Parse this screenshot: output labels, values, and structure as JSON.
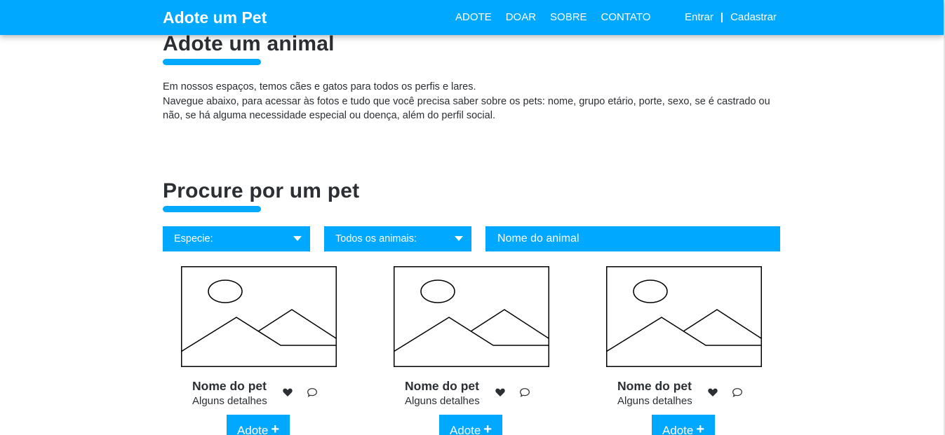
{
  "header": {
    "brand": "Adote um Pet",
    "nav": [
      "ADOTE",
      "DOAR",
      "SOBRE",
      "CONTATO"
    ],
    "login_label": "Entrar",
    "separator": "|",
    "signup_label": "Cadastrar",
    "color": "#00a8ff"
  },
  "intro": {
    "title": "Adote um animal",
    "line1": "Em nossos espaços, temos cães e gatos para todos os perfis e lares.",
    "line2": "Navegue abaixo, para acessar às fotos e tudo que você precisa saber sobre os pets: nome, grupo etário, porte, sexo, se é castrado ou não, se há alguma necessidade especial ou doença, além do perfil social."
  },
  "search": {
    "title": "Procure por um pet",
    "species_label": "Especie:",
    "animals_label": "Todos os animais:",
    "name_placeholder": "Nome do animal"
  },
  "pets": [
    {
      "name": "Nome do pet",
      "details": "Alguns detalhes",
      "adopt_label": "Adote",
      "image": "image-placeholder-icon"
    },
    {
      "name": "Nome do pet",
      "details": "Alguns detalhes",
      "adopt_label": "Adote",
      "image": "image-placeholder-icon"
    },
    {
      "name": "Nome do pet",
      "details": "Alguns detalhes",
      "adopt_label": "Adote",
      "image": "image-placeholder-icon"
    }
  ]
}
